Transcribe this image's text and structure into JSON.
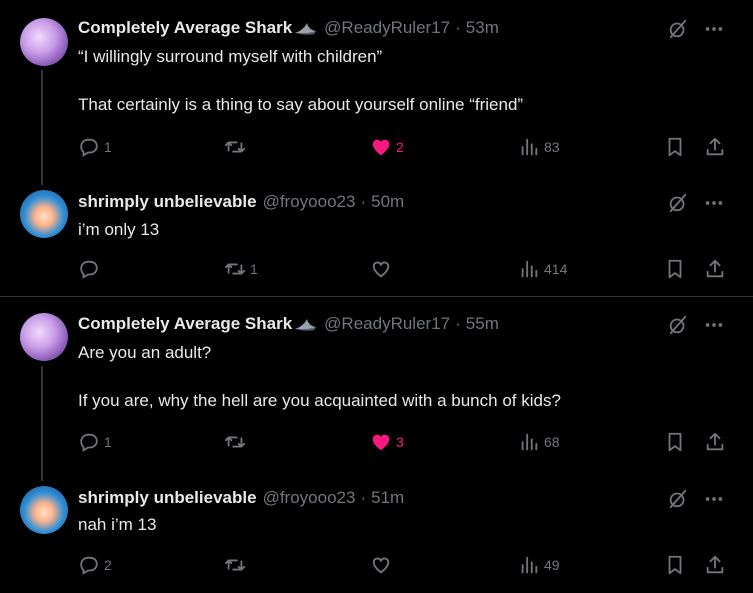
{
  "tweets": [
    {
      "name": "Completely Average Shark",
      "handle": "@ReadyRuler17",
      "time": "53m",
      "text": "“I willingly surround myself with children”\n\nThat certainly is a thing to say about yourself online “friend”",
      "replies": "1",
      "retweets": "",
      "likes": "2",
      "liked": true,
      "views": "83"
    },
    {
      "name": "shrimply unbelievable",
      "handle": "@froyooo23",
      "time": "50m",
      "text": "i’m only 13",
      "replies": "",
      "retweets": "1",
      "likes": "",
      "liked": false,
      "views": "414"
    },
    {
      "name": "Completely Average Shark",
      "handle": "@ReadyRuler17",
      "time": "55m",
      "text": "Are you an adult?\n\nIf you are, why the hell are you acquainted with a bunch of kids?",
      "replies": "1",
      "retweets": "",
      "likes": "3",
      "liked": true,
      "views": "68"
    },
    {
      "name": "shrimply unbelievable",
      "handle": "@froyooo23",
      "time": "51m",
      "text": "nah i’m 13",
      "replies": "2",
      "retweets": "",
      "likes": "",
      "liked": false,
      "views": "49"
    }
  ],
  "colors": {
    "like_active": "#f91880",
    "muted": "#71767b",
    "text": "#e7e9ea",
    "divider": "#2f3336"
  }
}
